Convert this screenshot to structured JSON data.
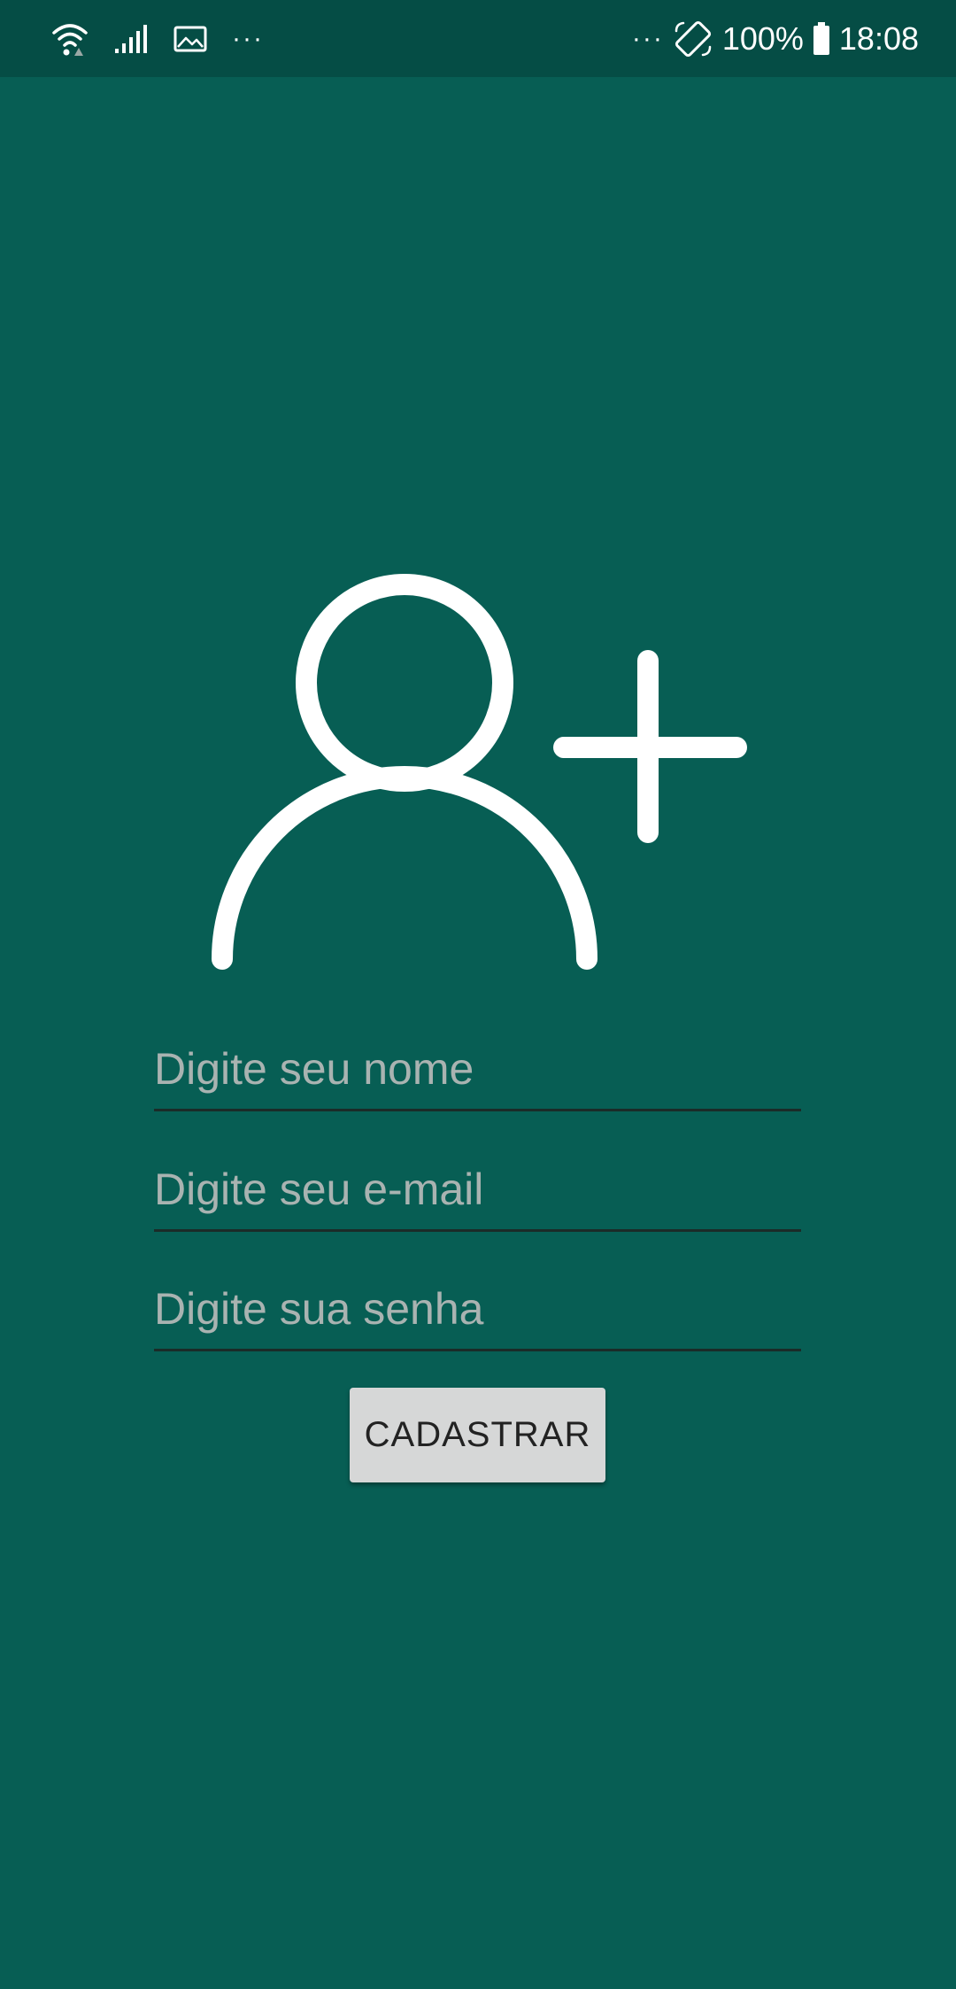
{
  "status_bar": {
    "icons_left": [
      "wifi-icon",
      "signal-icon",
      "gallery-icon"
    ],
    "left_dots": "···",
    "right_dots": "···",
    "icons_right": [
      "rotate-icon",
      "battery-icon"
    ],
    "battery": "100%",
    "time": "18:08"
  },
  "hero": {
    "icon": "add-user-icon"
  },
  "form": {
    "name_placeholder": "Digite seu nome",
    "email_placeholder": "Digite seu e-mail",
    "password_placeholder": "Digite sua senha",
    "name_value": "",
    "email_value": "",
    "password_value": ""
  },
  "actions": {
    "register_label": "CADASTRAR"
  },
  "colors": {
    "background": "#075e54",
    "status_bar": "#054d45",
    "button": "#d6d7d7"
  }
}
